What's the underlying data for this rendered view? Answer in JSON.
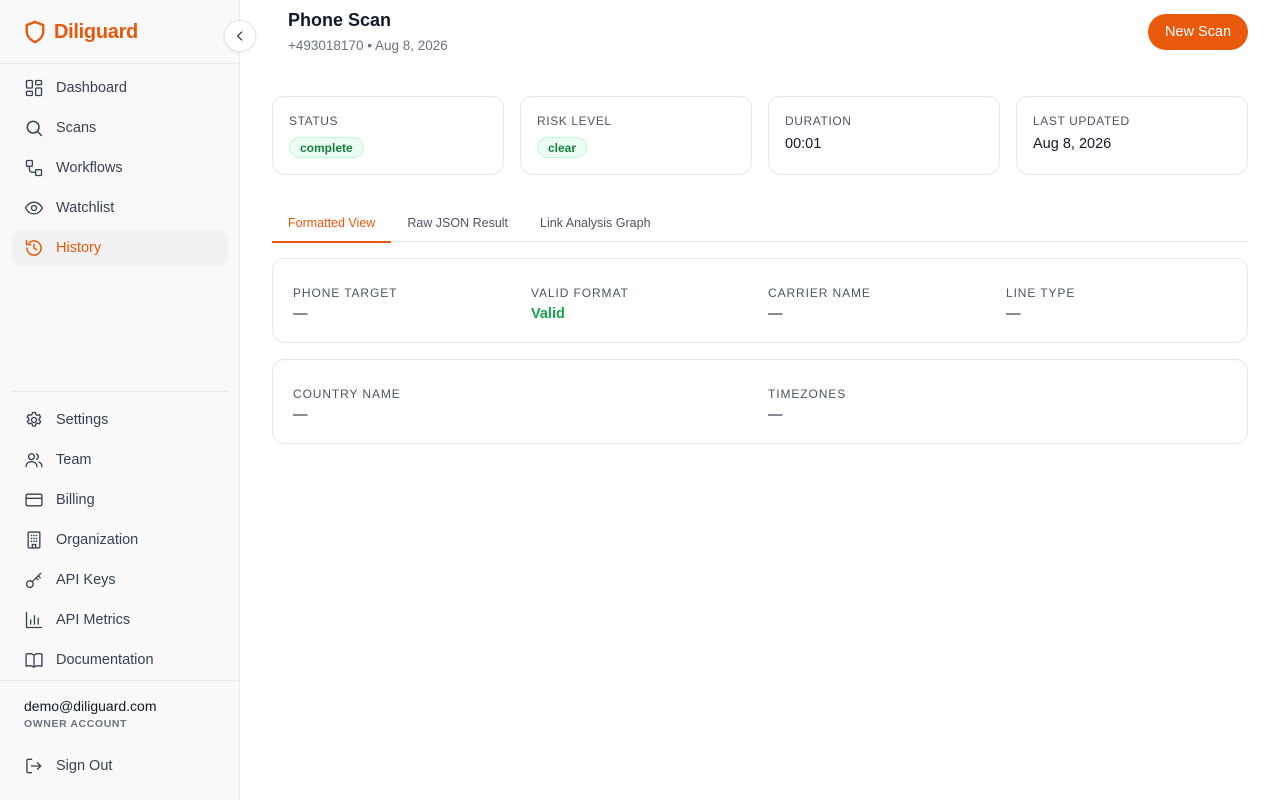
{
  "brand": {
    "name": "Diliguard",
    "accent": "#e8590c"
  },
  "sidebar": {
    "main_items": [
      {
        "label": "Dashboard",
        "icon": "dashboard-icon"
      },
      {
        "label": "Scans",
        "icon": "search-icon"
      },
      {
        "label": "Workflows",
        "icon": "workflow-icon"
      },
      {
        "label": "Watchlist",
        "icon": "eye-icon"
      },
      {
        "label": "History",
        "icon": "history-icon",
        "active": true
      }
    ],
    "bottom_items": [
      {
        "label": "Settings",
        "icon": "gear-icon"
      },
      {
        "label": "Team",
        "icon": "users-icon"
      },
      {
        "label": "Billing",
        "icon": "credit-card-icon"
      },
      {
        "label": "Organization",
        "icon": "building-icon"
      },
      {
        "label": "API Keys",
        "icon": "key-icon"
      },
      {
        "label": "API Metrics",
        "icon": "bar-chart-icon"
      },
      {
        "label": "Documentation",
        "icon": "book-icon"
      }
    ],
    "user": {
      "email": "demo@diliguard.com",
      "role": "OWNER ACCOUNT"
    },
    "sign_out_label": "Sign Out"
  },
  "header": {
    "title": "Phone Scan",
    "subtitle": "+493018170 • Aug 8, 2026",
    "new_scan_label": "New Scan"
  },
  "stats": {
    "status": {
      "label": "STATUS",
      "value": "complete"
    },
    "risk": {
      "label": "RISK LEVEL",
      "value": "clear"
    },
    "duration": {
      "label": "DURATION",
      "value": "00:01"
    },
    "updated": {
      "label": "LAST UPDATED",
      "value": "Aug 8, 2026"
    }
  },
  "tabs": [
    {
      "label": "Formatted View",
      "active": true
    },
    {
      "label": "Raw JSON Result"
    },
    {
      "label": "Link Analysis Graph"
    }
  ],
  "details": {
    "phone_target": {
      "label": "PHONE TARGET",
      "value": "—"
    },
    "valid_format": {
      "label": "VALID FORMAT",
      "value": "Valid"
    },
    "carrier_name": {
      "label": "CARRIER NAME",
      "value": "—"
    },
    "line_type": {
      "label": "LINE TYPE",
      "value": "—"
    },
    "country_name": {
      "label": "COUNTRY NAME",
      "value": "—"
    },
    "timezones": {
      "label": "TIMEZONES",
      "value": "—"
    }
  }
}
